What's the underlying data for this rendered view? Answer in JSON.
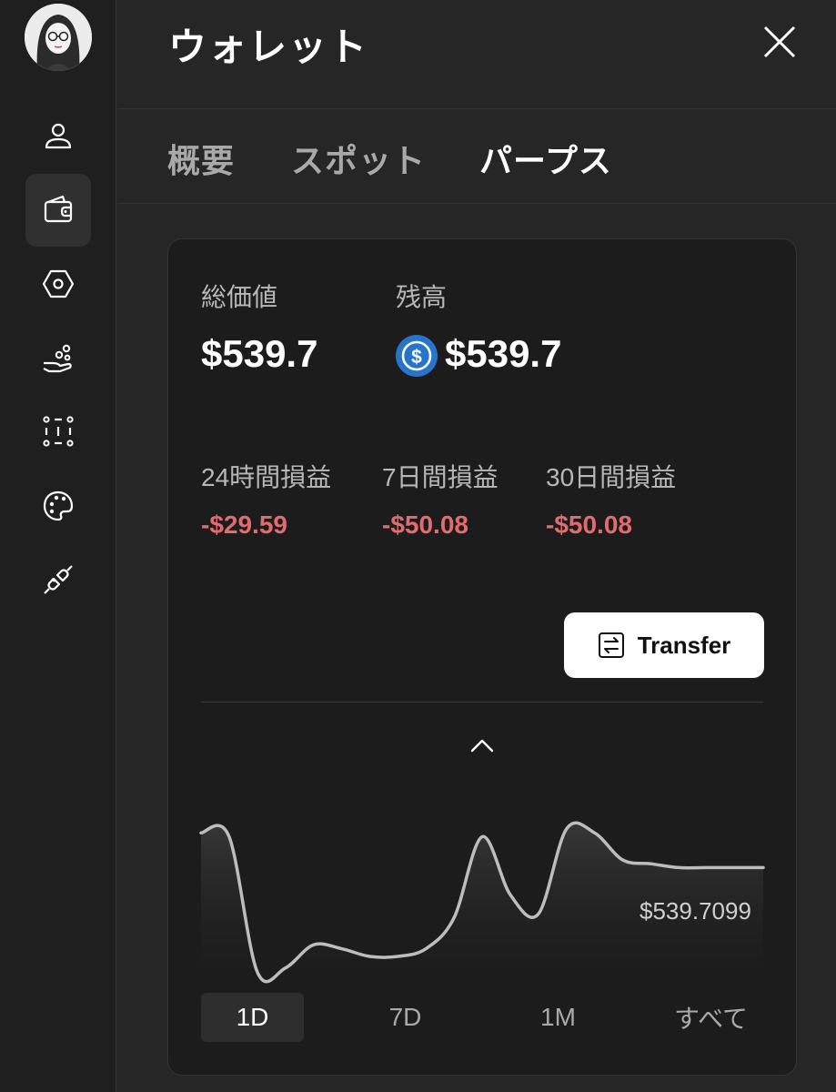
{
  "header": {
    "title": "ウォレット"
  },
  "tabs": [
    {
      "label": "概要",
      "active": false
    },
    {
      "label": "スポット",
      "active": false
    },
    {
      "label": "パープス",
      "active": true
    }
  ],
  "sidebar": {
    "items": [
      {
        "icon": "user-icon"
      },
      {
        "icon": "wallet-icon",
        "active": true
      },
      {
        "icon": "hexagon-icon"
      },
      {
        "icon": "hand-coins-icon"
      },
      {
        "icon": "grid-dots-icon"
      },
      {
        "icon": "palette-icon"
      },
      {
        "icon": "plug-icon"
      }
    ]
  },
  "summary": {
    "total_value_label": "総価値",
    "total_value": "$539.7",
    "balance_label": "残高",
    "balance": "$539.7",
    "balance_token_icon": "usdc-icon"
  },
  "pnl": [
    {
      "label": "24時間損益",
      "value": "-$29.59"
    },
    {
      "label": "7日間損益",
      "value": "-$50.08"
    },
    {
      "label": "30日間損益",
      "value": "-$50.08"
    }
  ],
  "transfer": {
    "label": "Transfer"
  },
  "chart": {
    "current_value_label": "$539.7099"
  },
  "chart_data": {
    "type": "area",
    "title": "",
    "xlabel": "",
    "ylabel": "",
    "x": [
      0,
      1,
      2,
      3,
      4,
      5,
      6,
      7,
      8,
      9,
      10,
      11,
      12,
      13,
      14,
      15,
      16,
      17,
      18,
      19,
      20
    ],
    "series": [
      {
        "values": [
          540.6,
          540.5,
          537.0,
          537.1,
          537.7,
          537.6,
          537.4,
          537.4,
          537.6,
          538.4,
          540.5,
          539.0,
          538.5,
          540.7,
          540.6,
          539.9,
          539.8,
          539.7,
          539.7,
          539.7,
          539.7
        ]
      }
    ],
    "grid": false,
    "legend": "none"
  },
  "ranges": [
    {
      "label": "1D",
      "active": true
    },
    {
      "label": "7D",
      "active": false
    },
    {
      "label": "1M",
      "active": false
    },
    {
      "label": "すべて",
      "active": false
    }
  ],
  "colors": {
    "negative": "#e26b70",
    "usdc_blue": "#2775ca",
    "background": "#262626",
    "card": "#1c1c1c"
  }
}
